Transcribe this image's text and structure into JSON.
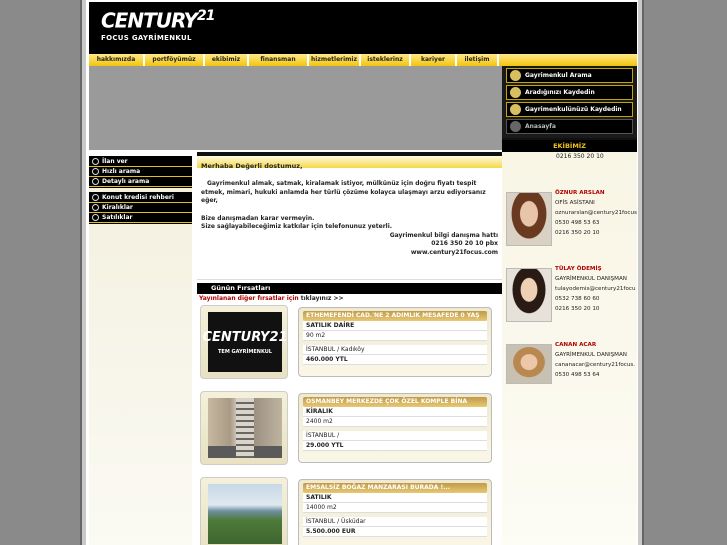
{
  "logo": {
    "brand": "CENTURY",
    "num": "21",
    "sub": "FOCUS GAYRİMENKUL"
  },
  "nav": [
    "hakkımızda",
    "portföyümüz",
    "ekibimiz",
    "finansman",
    "hizmetlerimiz",
    "isteklerinz",
    "kariyer",
    "iletişim"
  ],
  "quick": [
    {
      "label": "Gayrimenkul Arama"
    },
    {
      "label": "Aradığınızı Kaydedin"
    },
    {
      "label": "Gayrimenkulünüzü Kaydedin"
    },
    {
      "label": "Anasayfa"
    }
  ],
  "left_menu_1": [
    "İlan ver",
    "Hızlı arama",
    "Detaylı arama"
  ],
  "left_menu_2": [
    "Konut kredisi rehberi",
    "Kiralıklar",
    "Satılıklar"
  ],
  "welcome": {
    "title": "Merhaba Değerli dostumuz,",
    "p1": "Gayrimenkul almak, satmak, kiralamak istiyor, mülkünüz için doğru fiyatı tespit etmek, mimari, hukuki anlamda her türlü çözüme kolayca ulaşmayı arzu ediyorsanız eğer,",
    "p2": "Bize danışmadan karar vermeyin.",
    "p3": "Size sağlayabileceğimiz katkılar için telefonunuz yeterli.",
    "s1": "Gayrimenkul bilgi danışma hattı",
    "s2": "0216 350 20 10 pbx",
    "s3": "www.century21focus.com"
  },
  "firsat": {
    "title": "Günün Fırsatları",
    "link_red": "Yayınlanan diğer fırsatlar için",
    "link_rest": " tıklayınız >>"
  },
  "listings": [
    {
      "title": "ETHEMEFENDİ CAD.'NE 2 ADIMLIK MESAFEDE 0 YAŞ",
      "type": "SATILIK DAİRE",
      "size": "90 m2",
      "location": "İSTANBUL / Kadıköy",
      "price": "460.000 YTL",
      "thumb_text": "TEM GAYRİMENKUL"
    },
    {
      "title": "OSMANBEY MERKEZDE ÇOK ÖZEL KOMPLE BİNA",
      "type": "KİRALIK",
      "size": "2400 m2",
      "location": "İSTANBUL /",
      "price": "29.000 YTL"
    },
    {
      "title": "EMSALSİZ BOĞAZ MANZARASI BURADA !...",
      "type": "SATILIK",
      "size": "14000 m2",
      "location": "İSTANBUL / Üsküdar",
      "price": "5.500.000 EUR"
    }
  ],
  "team": {
    "title": "EKİBİMİZ",
    "top_phone": "0216 350 20 10",
    "agents": [
      {
        "name": "ÖZNUR ARSLAN",
        "role": "OFİS ASİSTANI",
        "email": "oznurarslan@century21focus",
        "mobile": "0530 498 53 63",
        "phone": "0216 350 20 10"
      },
      {
        "name": "TÜLAY ÖDEMİŞ",
        "role": "GAYRİMENKUL DANIŞMAN",
        "email": "tulayodemis@century21focu",
        "mobile": "0532 738 60 60",
        "phone": "0216 350 20 10"
      },
      {
        "name": "CANAN ACAR",
        "role": "GAYRİMENKUL DANIŞMAN",
        "email": "cananacar@century21focus.",
        "mobile": "0530 498 53 64"
      }
    ]
  }
}
